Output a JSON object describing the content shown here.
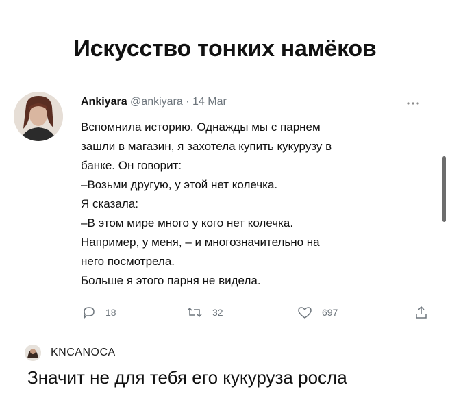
{
  "meme": {
    "title": "Искусство тонких намёков"
  },
  "tweet": {
    "author_name": "Ankiyara",
    "handle": "@ankiyara",
    "separator": "·",
    "date": "14 Mar",
    "more_icon": "more-horizontal-icon",
    "lines": [
      "Вспомнила историю. Однажды мы с парнем",
      "зашли в магазин, я захотела купить кукурузу в",
      "банке. Он говорит:",
      "–Возьми другую, у этой нет колечка.",
      "Я сказала:",
      "–В этом мире много у кого нет колечка.",
      "Например, у меня, – и многозначительно на",
      "него посмотрела.",
      "Больше я этого парня не видела."
    ],
    "actions": {
      "replies": "18",
      "retweets": "32",
      "likes": "697"
    }
  },
  "comment": {
    "username": "KNCANOCA",
    "text": "Значит не для тебя его кукуруза росла"
  },
  "colors": {
    "text": "#111111",
    "muted": "#6e767d",
    "background": "#ffffff"
  }
}
